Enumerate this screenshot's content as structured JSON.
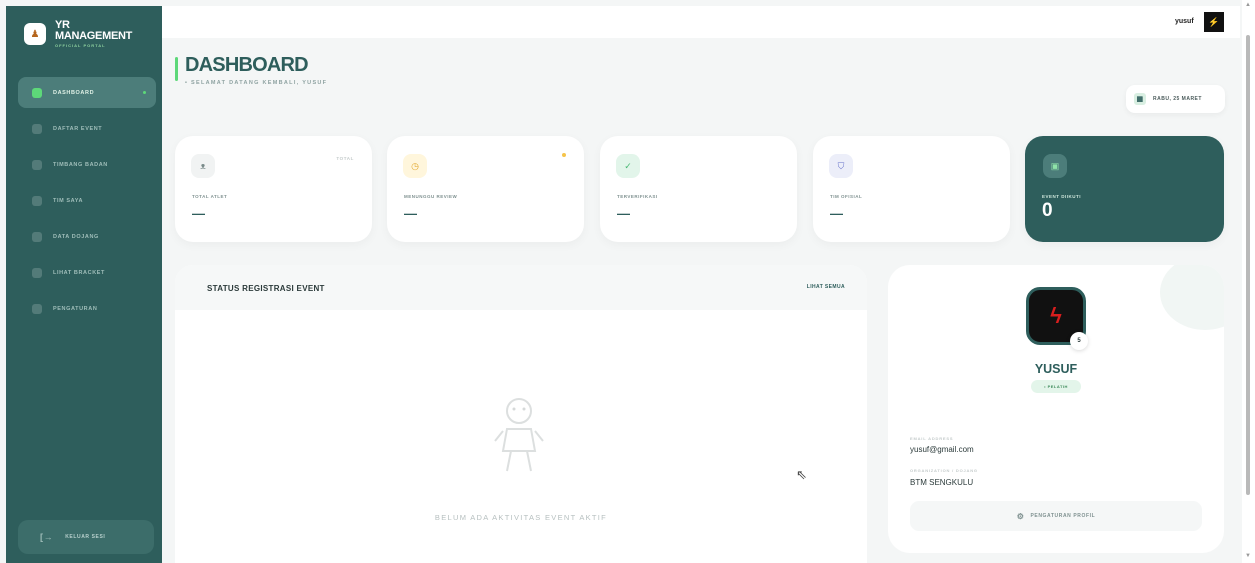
{
  "brand": {
    "title_line1": "YR",
    "title_line2": "MANAGEMENT",
    "subtitle": "OFFICIAL PORTAL"
  },
  "sidebar": {
    "items": [
      {
        "label": "DASHBOARD",
        "icon": "home-icon",
        "active": true
      },
      {
        "label": "DAFTAR EVENT",
        "icon": "calendar-icon",
        "active": false
      },
      {
        "label": "TIMBANG BADAN",
        "icon": "scale-icon",
        "active": false
      },
      {
        "label": "TIM SAYA",
        "icon": "team-icon",
        "active": false
      },
      {
        "label": "DATA DOJANG",
        "icon": "building-icon",
        "active": false
      },
      {
        "label": "LIHAT BRACKET",
        "icon": "bracket-icon",
        "active": false
      },
      {
        "label": "PENGATURAN",
        "icon": "gear-icon",
        "active": false
      }
    ],
    "logout_label": "KELUAR SESI"
  },
  "topbar": {
    "user_name": "yusuf"
  },
  "header": {
    "title": "DASHBOARD",
    "welcome": "• SELAMAT DATANG KEMBALI, YUSUF",
    "date": "RABU, 25 MARET"
  },
  "stats": [
    {
      "label": "TOTAL ATLET",
      "value": "—",
      "tag": "TOTAL",
      "icon": "athletes-icon"
    },
    {
      "label": "MENUNGGU REVIEW",
      "value": "—",
      "icon": "clock-icon"
    },
    {
      "label": "TERVERIFIKASI",
      "value": "—",
      "icon": "check-icon"
    },
    {
      "label": "TIM OFISIAL",
      "value": "—",
      "icon": "shield-icon"
    },
    {
      "label": "EVENT DIIKUTI",
      "value": "0",
      "icon": "event-icon"
    }
  ],
  "registration": {
    "title": "STATUS REGISTRASI EVENT",
    "link": "LIHAT SEMUA",
    "empty_text": "BELUM ADA AKTIVITAS EVENT AKTIF"
  },
  "profile": {
    "badge": "5",
    "name": "YUSUF",
    "role": "• PELATIH",
    "email_label": "EMAIL ADDRESS",
    "email": "yusuf@gmail.com",
    "org_label": "ORGANIZATION / DOJANG",
    "org": "BTM SENGKULU",
    "settings_button": "PENGATURAN PROFIL"
  },
  "colors": {
    "primary": "#2e5e5c",
    "accent": "#5dd879",
    "background": "#f4f6f6"
  }
}
